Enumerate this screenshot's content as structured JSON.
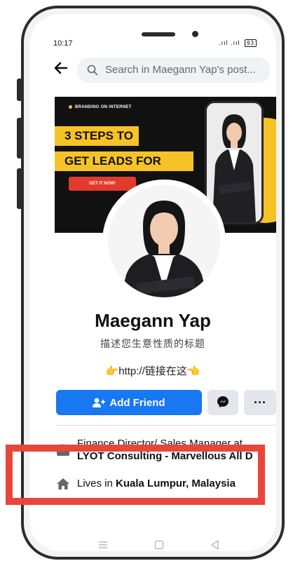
{
  "status_bar": {
    "time": "10:17",
    "battery": "93"
  },
  "search": {
    "placeholder": "Search in Maegann Yap's post..."
  },
  "cover": {
    "tag": "BRANDING ON INTERNET",
    "line1": "3 STEPS TO",
    "line2": "GET LEADS FOR FREE!",
    "cta": "GET IT NOW!"
  },
  "profile": {
    "name": "Maegann Yap",
    "bio": "描述您生意性质的标题",
    "link_text": "👉http://链接在这👈"
  },
  "actions": {
    "add_friend_label": "Add Friend",
    "more_label": "···"
  },
  "intro": {
    "work_line1": "Finance Director/ Sales Manager at",
    "work_line2": "LYOT Consulting - Marvellous All D",
    "lives_prefix": "Lives in ",
    "lives_place": "Kuala Lumpur, Malaysia"
  },
  "colors": {
    "brand": "#1877f2",
    "cover_accent": "#f6c326",
    "highlight": "#e8463a"
  },
  "icons": {
    "back": "arrow-left-icon",
    "search": "search-icon",
    "add_friend": "add-person-icon",
    "messenger": "messenger-icon",
    "work": "briefcase-icon",
    "home": "home-icon"
  }
}
